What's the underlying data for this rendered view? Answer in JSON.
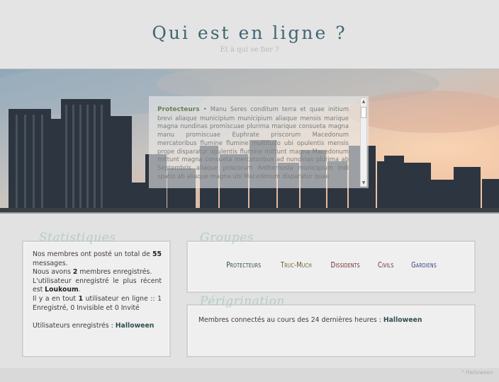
{
  "header": {
    "title": "Qui est en ligne ?",
    "subtitle": "Et à qui se fier ?"
  },
  "banner": {
    "lead": "Protecteurs",
    "text": " • Manu Seres conditum terra et quae initium brevi aliaque municipium municipium aliaque mensis marique magna nundinas promiscuae plurima marique consueta magna manu promiscuae Euphrate priscorum Macedonum mercatoribus flumine flumine multitudo ubi opulentis mensis prope disparatur opulentis flumine mittunt magna Macedonum mittunt magna consueta mercatoribus ad nundinas plurima ab Septembris aliaque priscorum Anthemusia municipium indi spatio ab aliaque magna ubi Macedonum disparatur quae"
  },
  "stats": {
    "title": "Statistiques",
    "line1_prefix": "Nos membres ont posté un total de ",
    "posts": "55",
    "line1_suffix": " messages.",
    "line2_prefix": "Nous avons ",
    "members": "2",
    "line2_suffix": " membres enregistrés.",
    "line3": "L'utilisateur enregistré le plus récent est ",
    "newest": "Loukoum",
    "line3_suffix": ".",
    "line4_prefix": "Il y a en tout ",
    "online_total": "1",
    "line4_suffix": " utilisateur en ligne :: 1 Enregistré, 0 Invisible et 0 Invité",
    "registered_label": "Utilisateurs enregistrés : ",
    "registered_user": "Halloween"
  },
  "groups": {
    "title": "Groupes",
    "items": [
      {
        "label": "Protecteurs",
        "color": "#2c4548"
      },
      {
        "label": "Truc-Much",
        "color": "#6b5a2a"
      },
      {
        "label": "Dissidents",
        "color": "#6a1e28"
      },
      {
        "label": "Civils",
        "color": "#5b2648"
      },
      {
        "label": "Gardiens",
        "color": "#2a3f78"
      }
    ]
  },
  "perigrination": {
    "title": "Périgrination",
    "label": "Membres connectés au cours des 24 dernières heures : ",
    "user": "Halloween"
  },
  "footer": {
    "credit": "Halloween"
  }
}
